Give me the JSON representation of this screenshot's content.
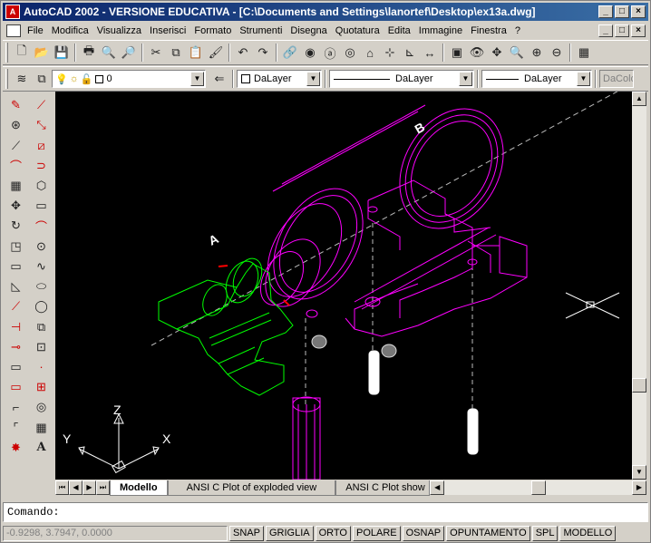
{
  "window": {
    "title": "AutoCAD 2002 - VERSIONE EDUCATIVA - [C:\\Documents and Settings\\lanortef\\Desktop\\ex13a.dwg]",
    "controls": [
      "_",
      "□",
      "×"
    ]
  },
  "menu": {
    "items": [
      "File",
      "Modifica",
      "Visualizza",
      "Inserisci",
      "Formato",
      "Strumenti",
      "Disegna",
      "Quotatura",
      "Edita",
      "Immagine",
      "Finestra",
      "?"
    ]
  },
  "layer_toolbar": {
    "layer_value": "0",
    "color_value": "DaLayer",
    "linetype_value": "DaLayer",
    "lineweight_value": "DaLayer",
    "plotstyle_value": "DaColo"
  },
  "drawing": {
    "label_a": "A",
    "label_b": "B",
    "ucs_z": "Z",
    "ucs_y": "Y",
    "ucs_x": "X"
  },
  "layout_tabs": [
    "Modello",
    "ANSI C Plot of exploded view",
    "ANSI C Plot show"
  ],
  "command": {
    "prompt": "Comando:"
  },
  "status": {
    "coordinates": "-0.9298, 3.7947, 0.0000",
    "buttons": [
      "SNAP",
      "GRIGLIA",
      "ORTO",
      "POLARE",
      "OSNAP",
      "OPUNTAMENTO",
      "SPL",
      "MODELLO"
    ]
  }
}
